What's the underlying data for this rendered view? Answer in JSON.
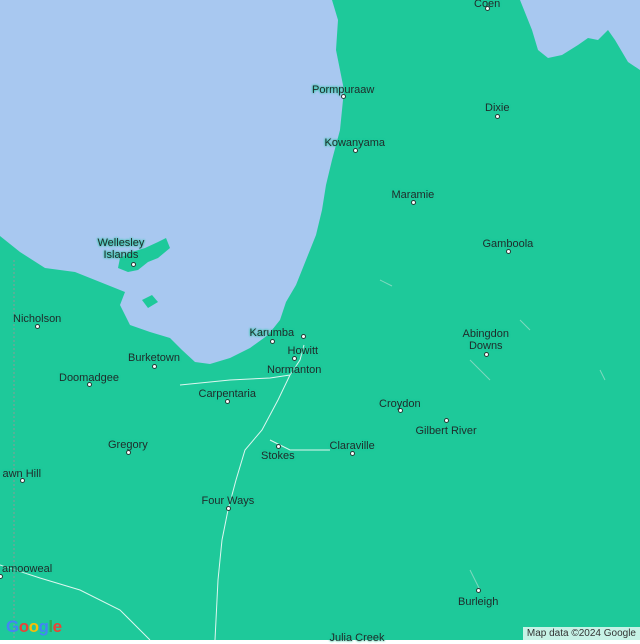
{
  "colors": {
    "water": "#a8c8f0",
    "land": "#1ec99a",
    "road": "#ffffff"
  },
  "places": [
    {
      "id": "coen",
      "label": "Coen"
    },
    {
      "id": "pormpuraaw",
      "label": "Pormpuraaw"
    },
    {
      "id": "dixie",
      "label": "Dixie"
    },
    {
      "id": "kowanyama",
      "label": "Kowanyama"
    },
    {
      "id": "maramie",
      "label": "Maramie"
    },
    {
      "id": "gamboola",
      "label": "Gamboola"
    },
    {
      "id": "wellesley",
      "label": "Wellesley\nIslands"
    },
    {
      "id": "nicholson",
      "label": "Nicholson"
    },
    {
      "id": "karumba",
      "label": "Karumba"
    },
    {
      "id": "howitt",
      "label": "Howitt"
    },
    {
      "id": "abingdon",
      "label": "Abingdon\nDowns"
    },
    {
      "id": "burketown",
      "label": "Burketown"
    },
    {
      "id": "normanton",
      "label": "Normanton"
    },
    {
      "id": "doomadgee",
      "label": "Doomadgee"
    },
    {
      "id": "carpentaria",
      "label": "Carpentaria"
    },
    {
      "id": "croydon",
      "label": "Croydon"
    },
    {
      "id": "gilbert",
      "label": "Gilbert River"
    },
    {
      "id": "gregory",
      "label": "Gregory"
    },
    {
      "id": "claraville",
      "label": "Claraville"
    },
    {
      "id": "stokes",
      "label": "Stokes"
    },
    {
      "id": "lawnhill",
      "label": "awn Hill"
    },
    {
      "id": "fourways",
      "label": "Four Ways"
    },
    {
      "id": "camooweal",
      "label": "amooweal"
    },
    {
      "id": "burleigh",
      "label": "Burleigh"
    },
    {
      "id": "juliacreek",
      "label": "Julia Creek"
    }
  ],
  "attribution": "Map data ©2024 Google",
  "logo": [
    "G",
    "o",
    "o",
    "g",
    "l",
    "e"
  ]
}
